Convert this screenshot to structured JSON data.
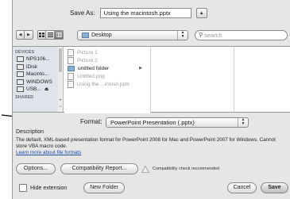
{
  "save_as": {
    "label": "Save As:",
    "filename": "Using the macintosh.pptx"
  },
  "toolbar": {
    "back": "◀",
    "forward": "▶",
    "location": "Desktop",
    "search_placeholder": "search"
  },
  "sidebar": {
    "devices_heading": "DEVICES",
    "items": [
      "NPS106...",
      "iDisk",
      "Macinto...",
      "WINDOWS",
      "USB..."
    ],
    "shared_heading": "SHARED"
  },
  "files": [
    {
      "name": "Picture 1",
      "kind": "file",
      "dimmed": true
    },
    {
      "name": "Picture 2",
      "kind": "file",
      "dimmed": true
    },
    {
      "name": "untitled folder",
      "kind": "folder",
      "dimmed": false
    },
    {
      "name": "Untitled.png",
      "kind": "file",
      "dimmed": true
    },
    {
      "name": "Using the ...intosh.pptx",
      "kind": "file",
      "dimmed": true
    }
  ],
  "format": {
    "label": "Format:",
    "value": "PowerPoint Presentation (.pptx)"
  },
  "description": {
    "heading": "Description",
    "text": "The default, XML-based presentation format for PowerPoint 2008 for Mac and PowerPoint 2007 for Windows. Cannot store VBA macro code.",
    "link": "Learn more about file formats"
  },
  "buttons": {
    "options": "Options...",
    "compatibility_report": "Compatibility Report...",
    "compatibility_note": "Compatibility check recommended",
    "hide_extension": "Hide extension",
    "new_folder": "New Folder",
    "cancel": "Cancel",
    "save": "Save"
  }
}
